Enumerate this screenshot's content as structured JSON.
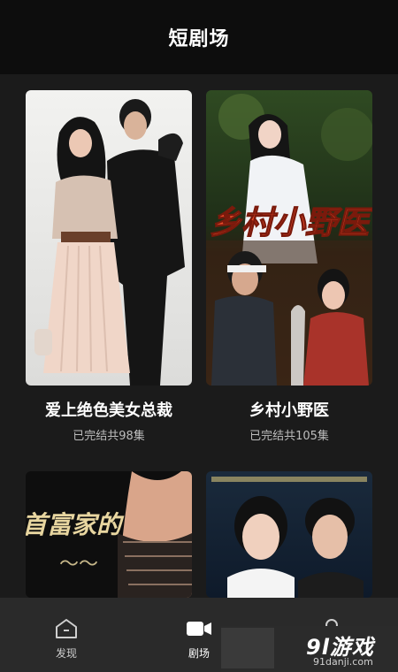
{
  "header": {
    "title": "短剧场"
  },
  "dramas": [
    {
      "title": "爱上绝色美女总裁",
      "status": "已完结共98集"
    },
    {
      "title": "乡村小野医",
      "status": "已完结共105集",
      "poster_text": "乡村小野医"
    },
    {
      "title": "",
      "status": "",
      "poster_text": "首富家的"
    },
    {
      "title": "",
      "status": ""
    }
  ],
  "tabbar": {
    "tabs": [
      {
        "label": "发现",
        "icon": "home-icon"
      },
      {
        "label": "剧场",
        "icon": "video-camera-icon",
        "active": true
      },
      {
        "label": "",
        "icon": "profile-icon"
      }
    ]
  },
  "watermark": {
    "brand": "9l游戏",
    "url": "91danji.com"
  },
  "colors": {
    "background": "#1b1b1b",
    "header": "#0d0d0d",
    "tabbar": "#2a2a2a",
    "poster_text": "#e84a2a"
  }
}
